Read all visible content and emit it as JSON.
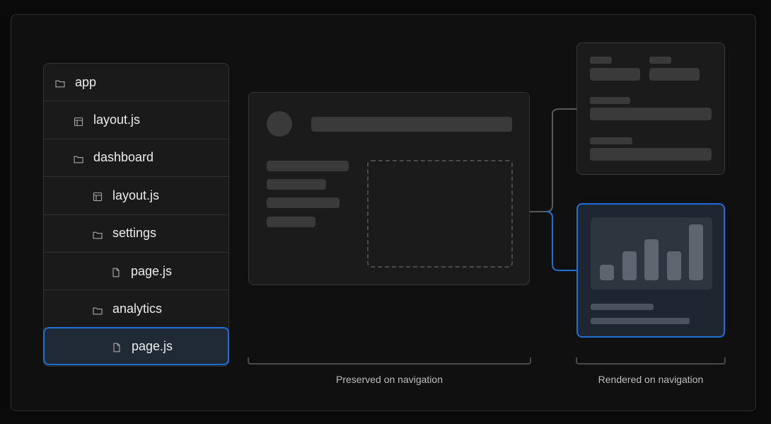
{
  "tree": {
    "items": [
      {
        "label": "app",
        "icon": "folder-icon",
        "level": 0
      },
      {
        "label": "layout.js",
        "icon": "layout-file-icon",
        "level": 1
      },
      {
        "label": "dashboard",
        "icon": "folder-icon",
        "level": 1
      },
      {
        "label": "layout.js",
        "icon": "layout-file-icon",
        "level": 2
      },
      {
        "label": "settings",
        "icon": "folder-icon",
        "level": 2
      },
      {
        "label": "page.js",
        "icon": "file-icon",
        "level": 3
      },
      {
        "label": "analytics",
        "icon": "folder-icon",
        "level": 2
      },
      {
        "label": "page.js",
        "icon": "file-icon",
        "level": 3,
        "active": true
      }
    ]
  },
  "captions": {
    "preserved": "Preserved on navigation",
    "rendered": "Rendered on navigation"
  },
  "colors": {
    "background": "#0a0a0a",
    "accent": "#1f6fd6",
    "active_row": "#1f2a36",
    "skeleton": "#3a3a3a"
  },
  "chart_bars": [
    0.22,
    0.4,
    0.57,
    0.4,
    0.77
  ]
}
